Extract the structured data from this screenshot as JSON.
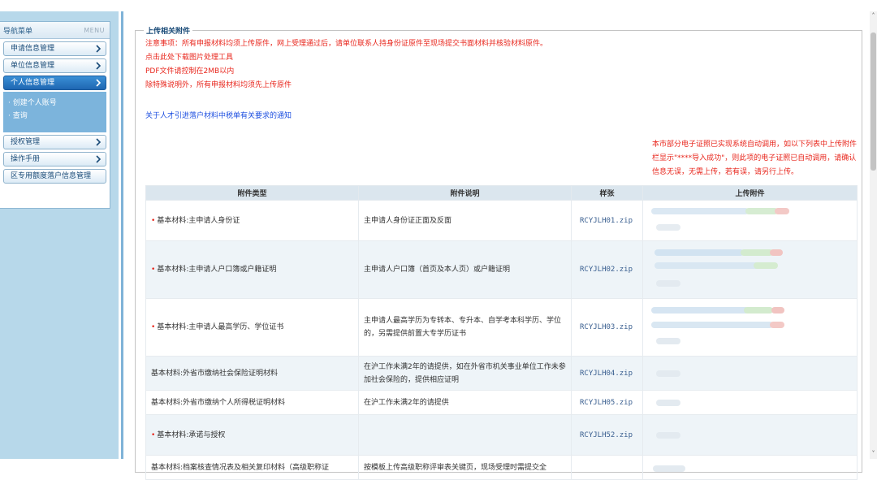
{
  "sidebar": {
    "title": "导航菜单",
    "tag": "MENU",
    "items_top": [
      {
        "label": "申请信息管理",
        "active": false
      },
      {
        "label": "单位信息管理",
        "active": false
      },
      {
        "label": "个人信息管理",
        "active": true
      }
    ],
    "subitems": [
      "· 创建个人账号",
      "· 查询"
    ],
    "items_bottom": [
      {
        "label": "授权管理"
      },
      {
        "label": "操作手册"
      },
      {
        "label": "区专用额度落户信息管理"
      }
    ]
  },
  "section": {
    "legend": "上传相关附件",
    "notice1": "注意事项：所有申报材料均须上传原件，网上受理通过后，请单位联系人持身份证原件至现场提交书面材料并核验材料原件。",
    "notice2": "点击此处下载图片处理工具",
    "notice3": "PDF文件请控制在2MB以内",
    "notice4": "除特殊说明外，所有申报材料均须先上传原件",
    "notice_link": "关于人才引进落户材料中税单有关要求的通知",
    "hint_right": "本市部分电子证照已实现系统自动调用，如以下列表中上传附件栏显示\"****导入成功\"，则此项的电子证照已自动调用，请确认信息无误，无需上传，若有误，请另行上传。"
  },
  "table": {
    "headers": [
      "附件类型",
      "附件说明",
      "样张",
      "上传附件"
    ],
    "rows": [
      {
        "type": "基本材料:主申请人身份证",
        "required": true,
        "desc": "主申请人身份证正面及反面",
        "sample": "RCYJLH01.zip"
      },
      {
        "type": "基本材料:主申请人户口簿或户籍证明",
        "required": true,
        "desc": "主申请人户口簿（首页及本人页）或户籍证明",
        "sample": "RCYJLH02.zip"
      },
      {
        "type": "基本材料:主申请人最高学历、学位证书",
        "required": true,
        "desc": "主申请人最高学历为专转本、专升本、自学考本科学历、学位的，另需提供前置大专学历证书",
        "sample": "RCYJLH03.zip"
      },
      {
        "type": "基本材料:外省市缴纳社会保险证明材料",
        "required": false,
        "desc": "在沪工作未满2年的请提供，如在外省市机关事业单位工作未参加社会保险的，提供相应证明",
        "sample": "RCYJLH04.zip"
      },
      {
        "type": "基本材料:外省市缴纳个人所得税证明材料",
        "required": false,
        "desc": "在沪工作未满2年的请提供",
        "sample": "RCYJLH05.zip"
      },
      {
        "type": "基本材料:承诺与授权",
        "required": true,
        "desc": "",
        "sample": "RCYJLH52.zip"
      },
      {
        "type": "基本材料:档案核查情况表及相关复印材料（高级职称证",
        "required": false,
        "desc": "按模板上传高级职称评审表关键页，现场受理时需提交全",
        "sample": ""
      }
    ]
  },
  "colors": {
    "accent": "#1f67b2",
    "warning": "#e8261c",
    "link": "#1d4fe0"
  }
}
